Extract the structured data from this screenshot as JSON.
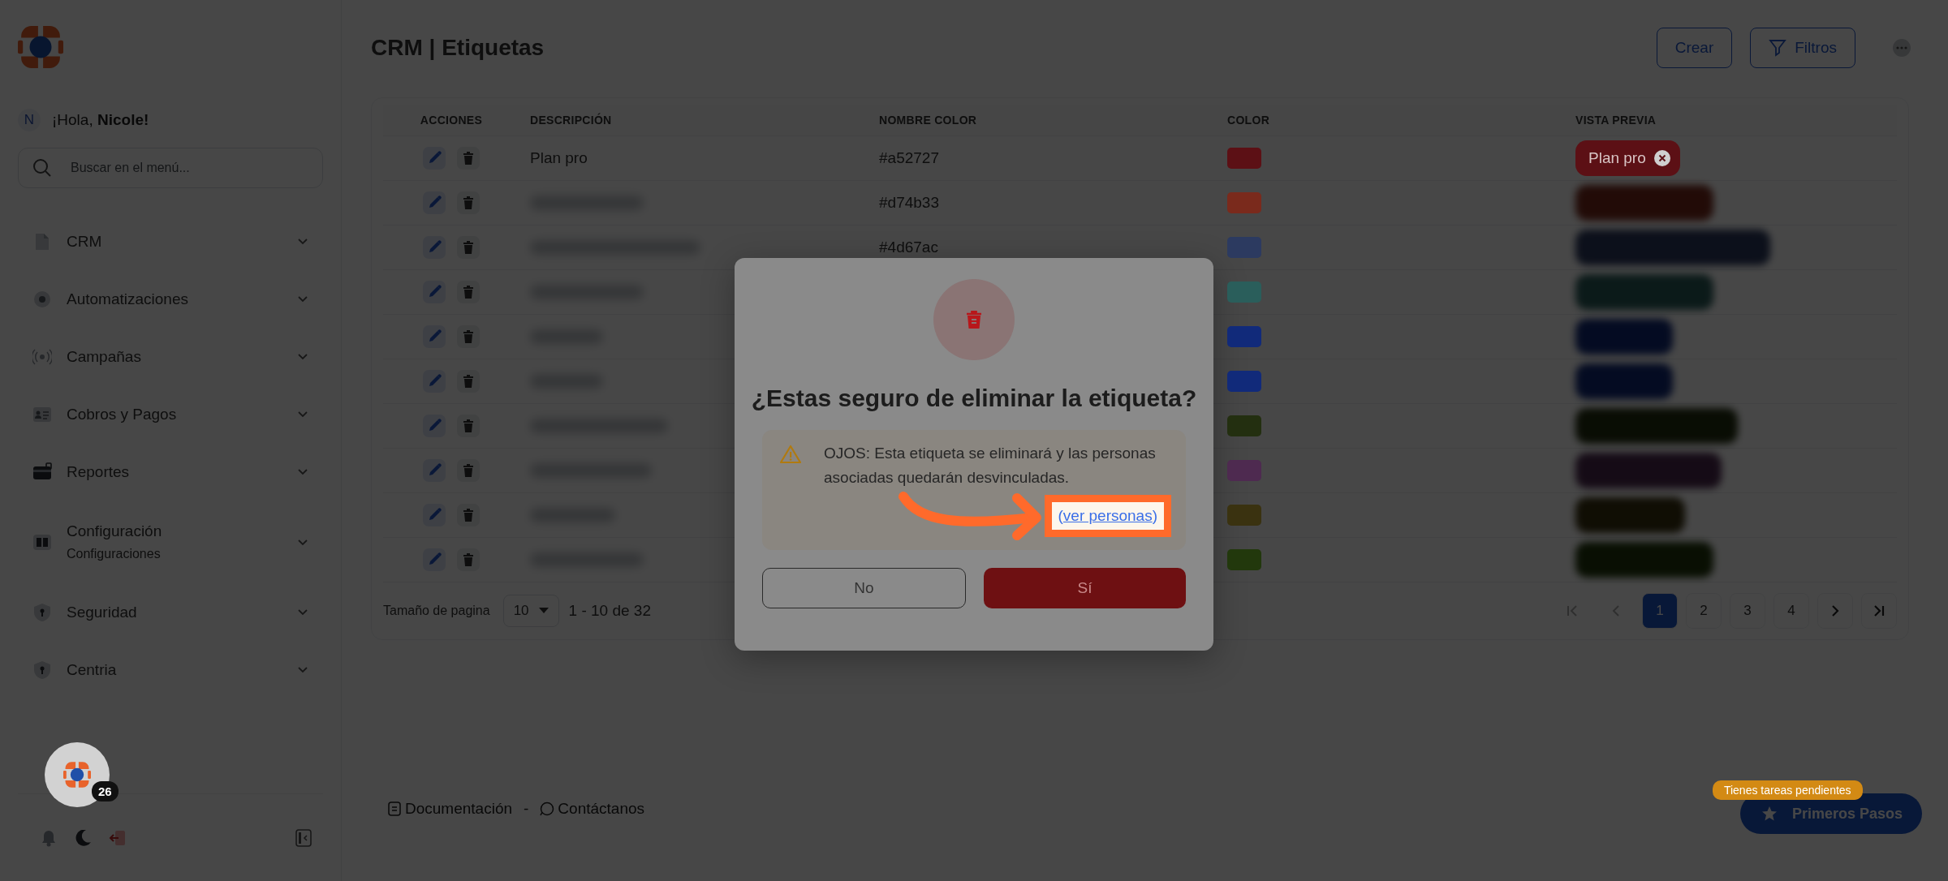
{
  "sidebar": {
    "greeting": {
      "avatar": "N",
      "prefix": "¡Hola, ",
      "name": "Nicole!"
    },
    "search": {
      "placeholder": "Buscar en el menú..."
    },
    "items": [
      {
        "label": "CRM"
      },
      {
        "label": "Automatizaciones"
      },
      {
        "label": "Campañas"
      },
      {
        "label": "Cobros y Pagos"
      },
      {
        "label": "Reportes"
      },
      {
        "label": "Configuración",
        "sublabel": "Configuraciones"
      },
      {
        "label": "Seguridad"
      },
      {
        "label": "Centria"
      }
    ],
    "chat_badge": "26"
  },
  "page": {
    "title": "CRM | Etiquetas",
    "buttons": [
      {
        "label": "Crear",
        "kind": "plain"
      },
      {
        "label": "Filtros",
        "kind": "filter"
      }
    ]
  },
  "table": {
    "columns": [
      "ACCIONES",
      "DESCRIPCIÓN",
      "NOMBRE COLOR",
      "COLOR",
      "VISTA PREVIA"
    ],
    "rows": [
      {
        "description": "Plan pro",
        "hex": "#a52727",
        "color": "#5c1015",
        "tag": "Plan pro",
        "blurred": false
      },
      {
        "hex": "#d74b33",
        "color": "#7a2a1c",
        "blurred": true
      },
      {
        "hex": "#4d67ac",
        "color": "#2c3a60",
        "blurred": true
      },
      {
        "color": "#2a5e5b",
        "blurred": true
      },
      {
        "color": "#112a7a",
        "blurred": true
      },
      {
        "color": "#112a7a",
        "blurred": true
      },
      {
        "color": "#232f10",
        "blurred": true
      },
      {
        "color": "#4e2a50",
        "blurred": true
      },
      {
        "color": "#3a3210",
        "blurred": true
      },
      {
        "color": "#22380c",
        "blurred": true
      }
    ],
    "pagination": {
      "size_label": "Tamaño de pagina",
      "size": "10",
      "range": "1 - 10 de 32",
      "pages": [
        {
          "label": "1",
          "selected": true
        },
        {
          "label": "2",
          "selected": false
        },
        {
          "label": "3",
          "selected": false
        },
        {
          "label": "4",
          "selected": false
        }
      ]
    }
  },
  "footer": {
    "links": [
      {
        "label": "Documentación",
        "kind": "docs"
      },
      {
        "label": "Contáctanos",
        "kind": "whatsapp"
      }
    ],
    "separator": "-"
  },
  "help": {
    "tip": "Tienes tareas pendientes",
    "button": "Primeros Pasos"
  },
  "dialog": {
    "title": "¿Estas seguro de eliminar la etiqueta?",
    "warning": {
      "text": "OJOS: Esta etiqueta se eliminará y las personas asociadas quedarán desvinculadas.",
      "link_open": "(",
      "link": "ver personas",
      "link_close": ")"
    },
    "buttons": [
      {
        "label": "No",
        "kind": "cancel"
      },
      {
        "label": "Sí",
        "kind": "confirm"
      }
    ]
  }
}
